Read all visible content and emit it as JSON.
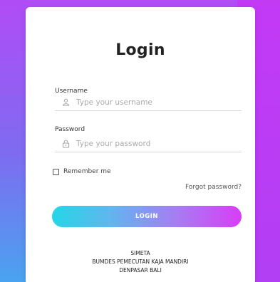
{
  "form": {
    "title": "Login",
    "username_label": "Username",
    "username_placeholder": "Type your username",
    "password_label": "Password",
    "password_placeholder": "Type your password",
    "remember_label": "Remember me",
    "forgot_label": "Forgot password?",
    "login_button": "LOGIN"
  },
  "footer": {
    "line1": "SIMETA",
    "line2": "BUMDES PEMECUTAN KAJA MANDIRI",
    "line3": "DENPASAR BALI"
  },
  "icons": {
    "username": "user-icon",
    "password": "lock-icon"
  },
  "colors": {
    "button_start": "#25d6e6",
    "button_end": "#d83df6",
    "background_top": "#b14cf6",
    "background_bottom": "#4aa3f0"
  }
}
